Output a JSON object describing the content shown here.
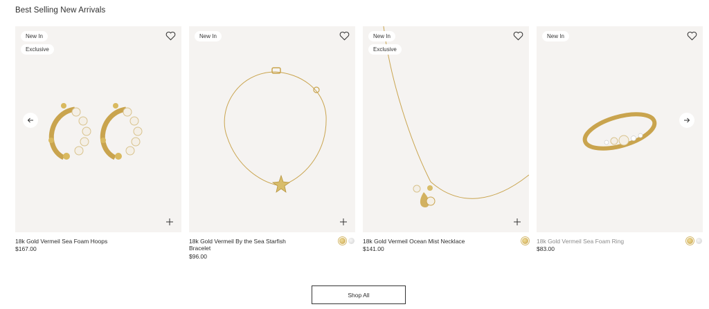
{
  "section": {
    "title": "Best Selling New Arrivals"
  },
  "carousel": {
    "products": [
      {
        "badges": [
          "New In",
          "Exclusive"
        ],
        "name": "18k Gold Vermeil Sea Foam Hoops",
        "price": "$167.00",
        "swatches": []
      },
      {
        "badges": [
          "New In"
        ],
        "name": "18k Gold Vermeil By the Sea Starfish Bracelet",
        "price": "$96.00",
        "swatches": [
          "gold",
          "silver"
        ]
      },
      {
        "badges": [
          "New In",
          "Exclusive"
        ],
        "name": "18k Gold Vermeil Ocean Mist Necklace",
        "price": "$141.00",
        "swatches": [
          "gold"
        ]
      },
      {
        "badges": [
          "New In"
        ],
        "name": "18k Gold Vermeil Sea Foam Ring",
        "price": "$83.00",
        "swatches": [
          "gold",
          "silver"
        ]
      }
    ],
    "icons": {
      "wishlist": "heart-icon",
      "quick_add": "plus-icon",
      "prev": "arrow-left-icon",
      "next": "arrow-right-icon"
    }
  },
  "cta": {
    "label": "Shop All"
  },
  "colors": {
    "card_bg": "#f5f3f1",
    "gold": "#c9a44e",
    "text": "#2b2b2b"
  }
}
